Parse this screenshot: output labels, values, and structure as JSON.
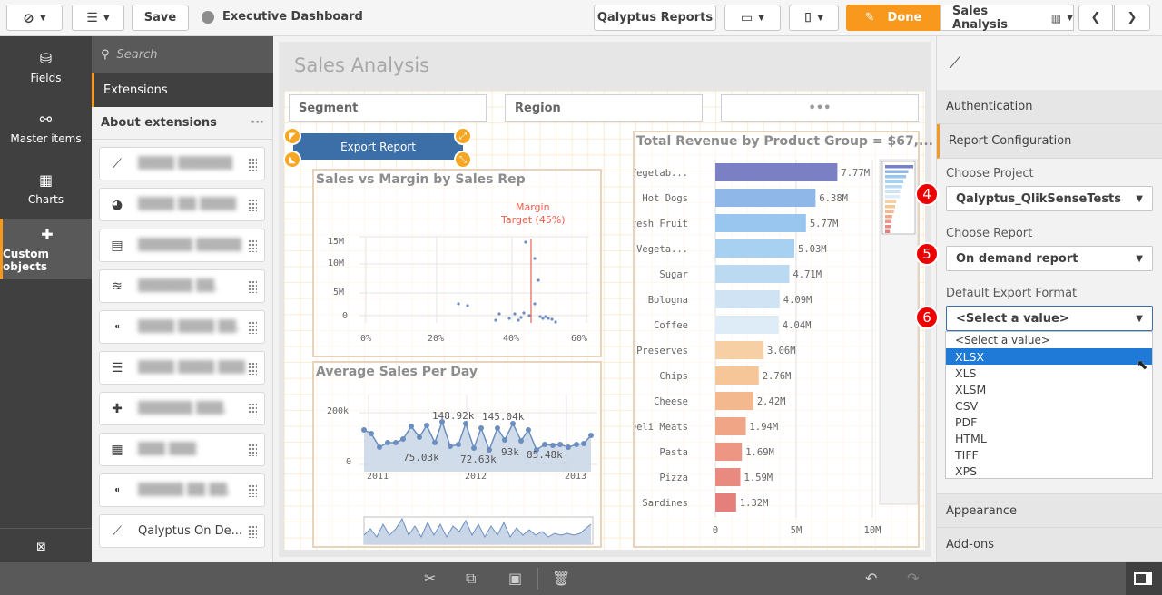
{
  "toolbar": {
    "save": "Save",
    "app_title": "Executive Dashboard",
    "qalyptus": "Qalyptus Reports",
    "done": "Done",
    "sheet_name": "Sales Analysis"
  },
  "rail": [
    {
      "label": "Fields",
      "icon": "database-icon"
    },
    {
      "label": "Master items",
      "icon": "link-icon"
    },
    {
      "label": "Charts",
      "icon": "bar-chart-icon"
    },
    {
      "label": "Custom objects",
      "icon": "puzzle-icon"
    }
  ],
  "assets": {
    "search_placeholder": "Search",
    "extensions_tab": "Extensions",
    "about": "About extensions",
    "last_item": "Qalyptus On De..."
  },
  "sheet": {
    "title": "Sales Analysis",
    "filters": [
      "Segment",
      "Region"
    ],
    "export_button": "Export Report"
  },
  "scatter": {
    "title": "Sales vs Margin by Sales Rep",
    "annotation_1": "Margin",
    "annotation_2": "Target (45%)",
    "yticks": [
      "15M",
      "10M",
      "5M",
      "0"
    ],
    "xticks": [
      "0%",
      "20%",
      "40%",
      "60%"
    ]
  },
  "line": {
    "title": "Average Sales Per Day",
    "yticks": [
      "200k",
      "0"
    ],
    "xticks": [
      "2011",
      "2012",
      "2013"
    ],
    "labels": [
      "148.92k",
      "145.04k",
      "75.03k",
      "72.63k",
      "93k",
      "85.48k"
    ]
  },
  "bar": {
    "title": "Total Revenue by Product Group = $67,...",
    "xticks": [
      "0",
      "5M",
      "10M"
    ]
  },
  "chart_data": {
    "type": "bar",
    "title": "Total Revenue by Product Group = $67,...",
    "categories": [
      "Fresh Vegetab...",
      "Hot Dogs",
      "Fresh Fruit",
      "Frozen Vegeta...",
      "Sugar",
      "Bologna",
      "Coffee",
      "Preserves",
      "Chips",
      "Cheese",
      "Deli Meats",
      "Pasta",
      "Pizza",
      "Sardines"
    ],
    "values": [
      7.77,
      6.38,
      5.77,
      5.03,
      4.71,
      4.09,
      4.04,
      3.06,
      2.76,
      2.42,
      1.94,
      1.69,
      1.59,
      1.32
    ],
    "value_labels": [
      "7.77M",
      "6.38M",
      "5.77M",
      "5.03M",
      "4.71M",
      "4.09M",
      "4.04M",
      "3.06M",
      "2.76M",
      "2.42M",
      "1.94M",
      "1.69M",
      "1.59M",
      "1.32M"
    ],
    "xlim": [
      0,
      10
    ],
    "unit": "M"
  },
  "right_panel": {
    "authentication": "Authentication",
    "report_config": "Report Configuration",
    "choose_project": "Choose Project",
    "project_value": "Qalyptus_QlikSenseTests",
    "choose_report": "Choose Report",
    "report_value": "On demand report",
    "export_format": "Default Export Format",
    "format_value": "<Select a value>",
    "badges": [
      "4",
      "5",
      "6"
    ],
    "options": [
      "<Select a value>",
      "XLSX",
      "XLS",
      "XLSM",
      "CSV",
      "PDF",
      "HTML",
      "TIFF",
      "XPS"
    ],
    "appearance": "Appearance",
    "addons": "Add-ons"
  },
  "colors": {
    "accent": "#f8981d",
    "selected": "#1e7ad6",
    "badge": "#e00000",
    "export": "#3c6fa8"
  }
}
